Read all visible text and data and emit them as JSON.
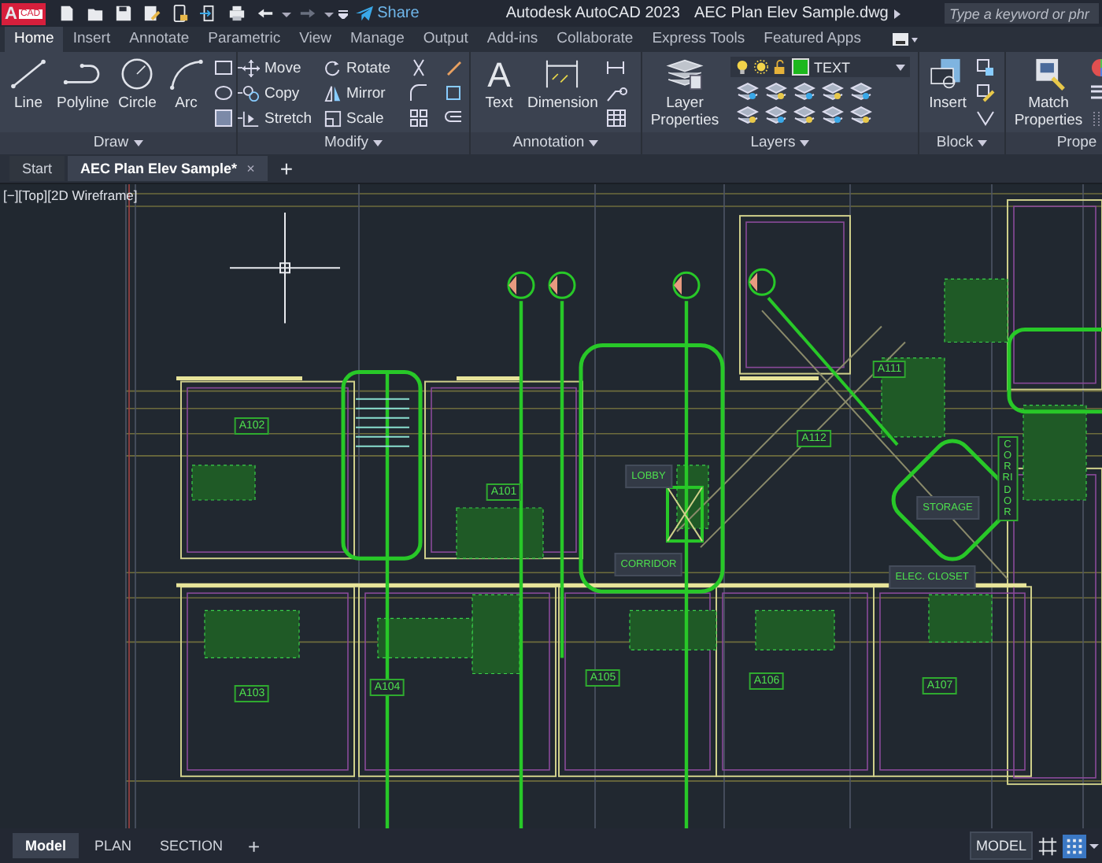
{
  "title_bar": {
    "logo_letter": "A",
    "logo_badge": "CAD",
    "share": "Share",
    "title": "Autodesk AutoCAD 2023",
    "file": "AEC Plan Elev Sample.dwg",
    "search": {
      "placeholder": "Type a keyword or phr"
    }
  },
  "ribbon_tabs": [
    {
      "label": "Home",
      "selected": true
    },
    {
      "label": "Insert",
      "selected": false
    },
    {
      "label": "Annotate",
      "selected": false
    },
    {
      "label": "Parametric",
      "selected": false
    },
    {
      "label": "View",
      "selected": false
    },
    {
      "label": "Manage",
      "selected": false
    },
    {
      "label": "Output",
      "selected": false
    },
    {
      "label": "Add-ins",
      "selected": false
    },
    {
      "label": "Collaborate",
      "selected": false
    },
    {
      "label": "Express Tools",
      "selected": false
    },
    {
      "label": "Featured Apps",
      "selected": false
    }
  ],
  "ribbon": {
    "draw": {
      "title": "Draw",
      "tools": [
        "Line",
        "Polyline",
        "Circle",
        "Arc"
      ]
    },
    "modify": {
      "title": "Modify",
      "tools": [
        "Move",
        "Copy",
        "Stretch",
        "Rotate",
        "Mirror",
        "Scale"
      ]
    },
    "annotation": {
      "title": "Annotation",
      "text_icon": "A",
      "tools": [
        "Text",
        "Dimension"
      ]
    },
    "layers": {
      "title": "Layers",
      "tool": "Layer Properties",
      "current": {
        "name": "TEXT",
        "color": "#1db81d"
      }
    },
    "block": {
      "title": "Block",
      "tool": "Insert"
    },
    "properties": {
      "title": "Prope",
      "tool": "Match Properties"
    }
  },
  "file_tabs": [
    {
      "label": "Start",
      "selected": false
    },
    {
      "label": "AEC Plan Elev Sample*",
      "selected": true,
      "close": "×"
    }
  ],
  "new_tab": "+",
  "viewport": {
    "label": "[−][Top][2D Wireframe]",
    "rooms": [
      {
        "label": "A102",
        "kind": "unit"
      },
      {
        "label": "A101",
        "kind": "unit"
      },
      {
        "label": "LOBBY",
        "kind": "space"
      },
      {
        "label": "CORRIDOR",
        "kind": "space"
      },
      {
        "label": "A112",
        "kind": "unit"
      },
      {
        "label": "A111",
        "kind": "unit"
      },
      {
        "label": "STORAGE",
        "kind": "space"
      },
      {
        "label": "ELEC. CLOSET",
        "kind": "space"
      },
      {
        "label": "CORRIDOR",
        "kind": "vertical"
      },
      {
        "label": "A103",
        "kind": "unit"
      },
      {
        "label": "A104",
        "kind": "unit"
      },
      {
        "label": "A105",
        "kind": "unit"
      },
      {
        "label": "A106",
        "kind": "unit"
      },
      {
        "label": "A107",
        "kind": "unit"
      }
    ]
  },
  "layout_tabs": [
    {
      "label": "Model",
      "selected": true
    },
    {
      "label": "PLAN",
      "selected": false
    },
    {
      "label": "SECTION",
      "selected": false
    }
  ],
  "add_layout": "+",
  "status_bar": {
    "space": "MODEL",
    "toggles": [
      {
        "kind": "grid",
        "on": false
      },
      {
        "kind": "snap",
        "on": true
      }
    ]
  }
}
